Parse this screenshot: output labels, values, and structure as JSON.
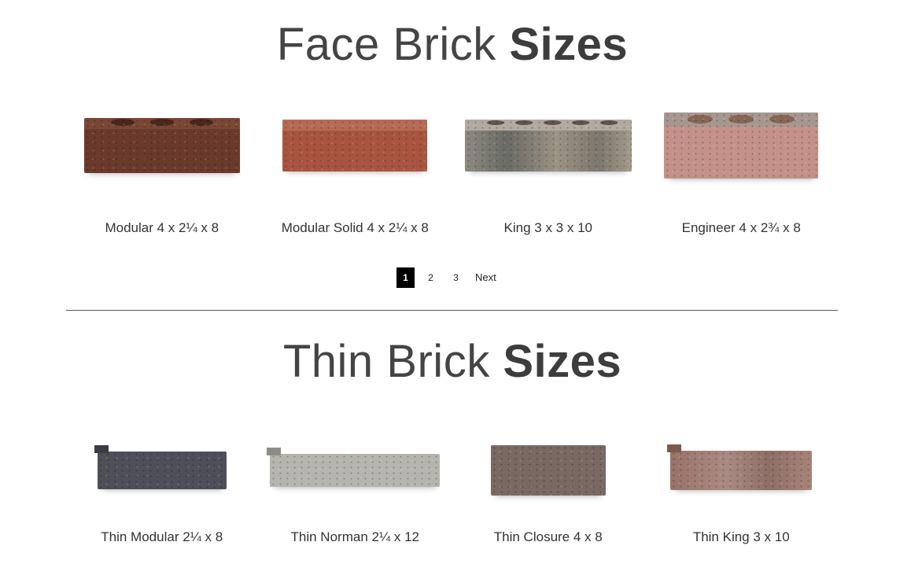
{
  "face_section": {
    "title_light": "Face Brick",
    "title_bold": "Sizes",
    "items": [
      {
        "label": "Modular 4 x 2¼ x 8"
      },
      {
        "label": "Modular Solid 4 x 2¼ x 8"
      },
      {
        "label": "King 3 x 3 x 10"
      },
      {
        "label": "Engineer 4 x 2¾ x 8"
      }
    ]
  },
  "pagination": {
    "pages": [
      "1",
      "2",
      "3"
    ],
    "current": "1",
    "next_label": "Next"
  },
  "thin_section": {
    "title_light": "Thin Brick",
    "title_bold": "Sizes",
    "items": [
      {
        "label": "Thin Modular 2¼ x 8"
      },
      {
        "label": "Thin Norman 2¼ x 12"
      },
      {
        "label": "Thin Closure 4 x 8"
      },
      {
        "label": "Thin King 3 x 10"
      }
    ]
  }
}
